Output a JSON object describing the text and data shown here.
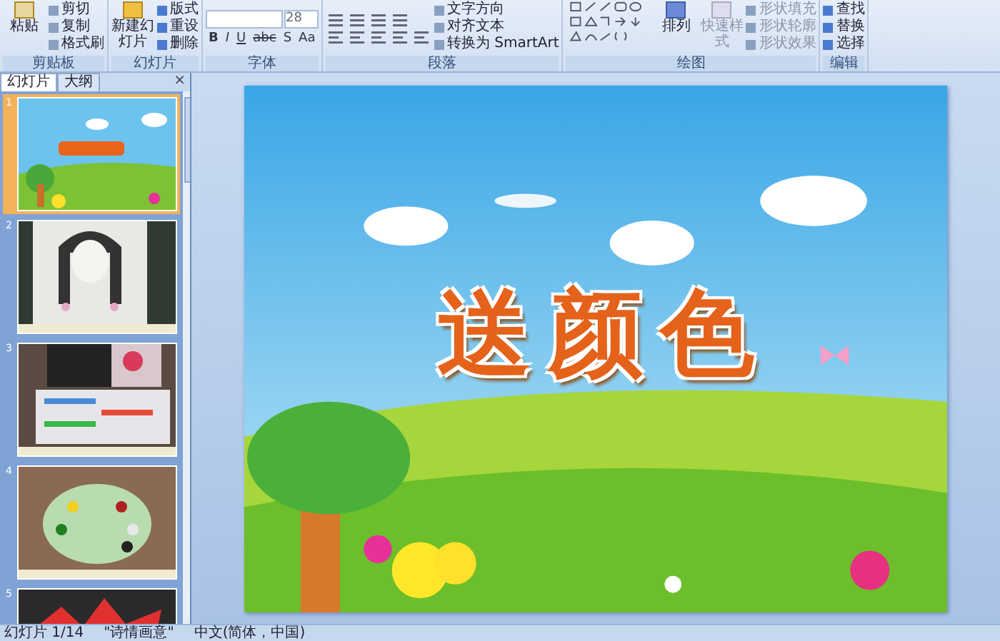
{
  "ribbon": {
    "clipboard": {
      "label": "剪贴板",
      "paste": "粘贴",
      "items": [
        "剪切",
        "复制",
        "格式刷"
      ]
    },
    "slides": {
      "label": "幻灯片",
      "new_slide": "新建幻灯片",
      "items": [
        "版式",
        "重设",
        "删除"
      ]
    },
    "font": {
      "label": "字体",
      "size": "28",
      "buttons": [
        "B",
        "I",
        "U",
        "abc",
        "S",
        "Aa"
      ]
    },
    "paragraph": {
      "label": "段落",
      "items": [
        "文字方向",
        "对齐文本",
        "转换为 SmartArt"
      ]
    },
    "drawing": {
      "label": "绘图",
      "arrange": "排列",
      "quick_styles": {
        "label": "快速样式",
        "disabled": true
      },
      "items": [
        {
          "label": "形状填充",
          "disabled": true
        },
        {
          "label": "形状轮廓",
          "disabled": true
        },
        {
          "label": "形状效果",
          "disabled": true
        }
      ]
    },
    "editing": {
      "label": "编辑",
      "items": [
        "查找",
        "替换",
        "选择"
      ]
    }
  },
  "panel": {
    "close": "×",
    "tabs": [
      {
        "label": "幻灯片",
        "selected": true
      },
      {
        "label": "大纲",
        "selected": false
      }
    ],
    "slides": [
      {
        "number": "1",
        "selected": true,
        "kind": "title"
      },
      {
        "number": "2",
        "selected": false,
        "kind": "drawing"
      },
      {
        "number": "3",
        "selected": false,
        "kind": "paints"
      },
      {
        "number": "4",
        "selected": false,
        "kind": "palette"
      },
      {
        "number": "5",
        "selected": false,
        "kind": "star"
      }
    ]
  },
  "slide": {
    "title": "送颜色"
  },
  "status_bar": [
    "幻灯片 1/14",
    "\"诗情画意\"",
    "中文(简体，中国)"
  ]
}
